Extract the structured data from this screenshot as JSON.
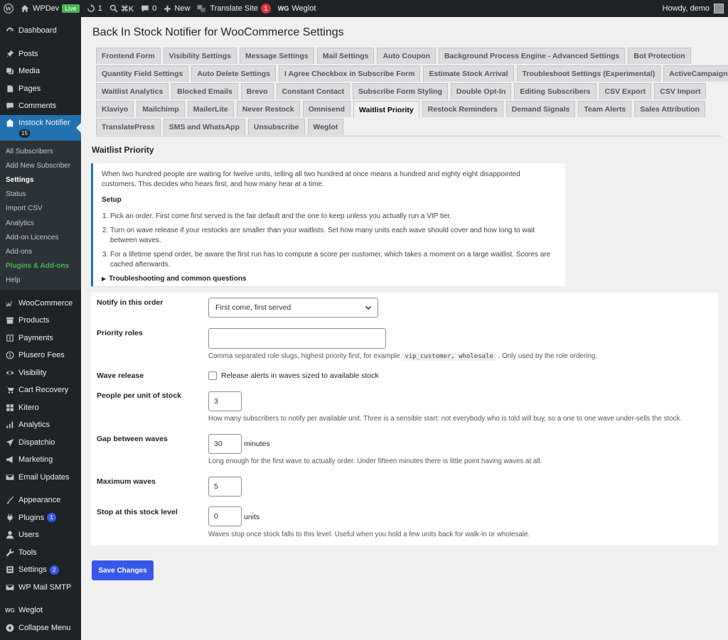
{
  "admin_bar": {
    "site_name": "WPDev",
    "live_badge": "Live",
    "updates_count": "1",
    "shortcut": "⌘K",
    "comments_count": "0",
    "new_label": "New",
    "translate_label": "Translate Site",
    "translate_count": "1",
    "weglot_mark": "WG",
    "weglot_label": "Weglot",
    "greeting": "Howdy, demo"
  },
  "sidebar": {
    "top_items": [
      {
        "label": "Dashboard",
        "icon": "dashboard-icon"
      },
      {
        "label": "Posts",
        "icon": "pin-icon"
      },
      {
        "label": "Media",
        "icon": "media-icon"
      },
      {
        "label": "Pages",
        "icon": "page-icon"
      },
      {
        "label": "Comments",
        "icon": "comment-icon"
      }
    ],
    "current": {
      "label": "Instock Notifier",
      "badge": "15",
      "icon": "house-icon"
    },
    "submenu": [
      {
        "label": "All Subscribers"
      },
      {
        "label": "Add New Subscriber"
      },
      {
        "label": "Settings"
      },
      {
        "label": "Status"
      },
      {
        "label": "Import CSV"
      },
      {
        "label": "Analytics"
      },
      {
        "label": "Add-on Licences"
      },
      {
        "label": "Add-ons"
      },
      {
        "label": "Plugins & Add-ons"
      },
      {
        "label": "Help"
      }
    ],
    "commerce_items": [
      {
        "label": "WooCommerce",
        "icon": "woo-icon"
      },
      {
        "label": "Products",
        "icon": "box-icon"
      },
      {
        "label": "Payments",
        "icon": "dollar-icon"
      },
      {
        "label": "Plusero Fees",
        "icon": "dollar-circle-icon"
      },
      {
        "label": "Visibility",
        "icon": "eye-icon"
      },
      {
        "label": "Cart Recovery",
        "icon": "cart-icon"
      },
      {
        "label": "Kitero",
        "icon": "grid-icon"
      },
      {
        "label": "Analytics",
        "icon": "bar-chart-icon"
      },
      {
        "label": "Dispatchio",
        "icon": "plane-icon"
      },
      {
        "label": "Marketing",
        "icon": "megaphone-icon"
      },
      {
        "label": "Email Updates",
        "icon": "envelope-icon"
      }
    ],
    "admin_items": [
      {
        "label": "Appearance",
        "icon": "brush-icon"
      },
      {
        "label": "Plugins",
        "icon": "plug-icon",
        "badge": "1"
      },
      {
        "label": "Users",
        "icon": "user-icon"
      },
      {
        "label": "Tools",
        "icon": "wrench-icon"
      },
      {
        "label": "Settings",
        "icon": "settings-icon",
        "badge": "2"
      },
      {
        "label": "WP Mail SMTP",
        "icon": "mail-icon"
      }
    ],
    "bottom_items": [
      {
        "label": "Weglot",
        "icon": "weglot-icon"
      },
      {
        "label": "Collapse Menu",
        "icon": "collapse-icon"
      }
    ]
  },
  "page": {
    "title": "Back In Stock Notifier for WooCommerce Settings",
    "section_title": "Waitlist Priority"
  },
  "tabs": {
    "rows": [
      [
        "Frontend Form",
        "Visibility Settings",
        "Message Settings",
        "Mail Settings",
        "Auto Coupon",
        "Background Process Engine - Advanced Settings",
        "Bot Protection"
      ],
      [
        "Quantity Field Settings",
        "Auto Delete Settings",
        "I Agree Checkbox in Subscribe Form",
        "Estimate Stock Arrival",
        "Troubleshoot Settings (Experimental)",
        "ActiveCampaign"
      ],
      [
        "Waitlist Analytics",
        "Blocked Emails",
        "Brevo",
        "Constant Contact",
        "Subscribe Form Styling",
        "Double Opt-In",
        "Editing Subscribers",
        "CSV Export",
        "CSV Import"
      ],
      [
        "Klaviyo",
        "Mailchimp",
        "MailerLite",
        "Never Restock",
        "Omnisend",
        "Waitlist Priority",
        "Restock Reminders",
        "Demand Signals",
        "Team Alerts",
        "Sales Attribution"
      ],
      [
        "TranslatePress",
        "SMS and WhatsApp",
        "Unsubscribe",
        "Weglot"
      ]
    ],
    "active": "Waitlist Priority"
  },
  "notice": {
    "intro": "When two hundred people are waiting for twelve units, telling all two hundred at once means a hundred and eighty eight disappointed customers. This decides who hears first, and how many hear at a time.",
    "setup_heading": "Setup",
    "steps": [
      "Pick an order. First come first served is the fair default and the one to keep unless you actually run a VIP tier.",
      "Turn on wave release if your restocks are smaller than your waitlists. Set how many units each wave should cover and how long to wait between waves.",
      "For a lifetime spend order, be aware the first run has to compute a score per customer, which takes a moment on a large waitlist. Scores are cached afterwards."
    ],
    "details_summary": "Troubleshooting and common questions"
  },
  "form": {
    "notify_order": {
      "label": "Notify in this order",
      "value": "First come, first served"
    },
    "priority_roles": {
      "label": "Priority roles",
      "value": "",
      "desc_before": "Comma separated role slugs, highest priority first, for example",
      "desc_code": "vip_customer, wholesale",
      "desc_after": ". Only used by the role ordering."
    },
    "wave_release": {
      "label": "Wave release",
      "checkbox_label": "Release alerts in waves sized to available stock",
      "checked": false
    },
    "people_per_unit": {
      "label": "People per unit of stock",
      "value": "3",
      "desc": "How many subscribers to notify per available unit. Three is a sensible start: not everybody who is told will buy, so a one to one wave under-sells the stock."
    },
    "gap_between_waves": {
      "label": "Gap between waves",
      "value": "30",
      "unit": "minutes",
      "desc": "Long enough for the first wave to actually order. Under fifteen minutes there is little point having waves at all."
    },
    "maximum_waves": {
      "label": "Maximum waves",
      "value": "5"
    },
    "stop_stock_level": {
      "label": "Stop at this stock level",
      "value": "0",
      "unit": "units",
      "desc": "Waves stop once stock falls to this level. Useful when you hold a few units back for walk-in or wholesale."
    }
  },
  "save_button": "Save Changes",
  "colors": {
    "admin_dark": "#1d2327",
    "highlight_blue": "#2271b1",
    "button_blue": "#3858e9",
    "badge_red": "#d63638",
    "live_green": "#46b450"
  }
}
